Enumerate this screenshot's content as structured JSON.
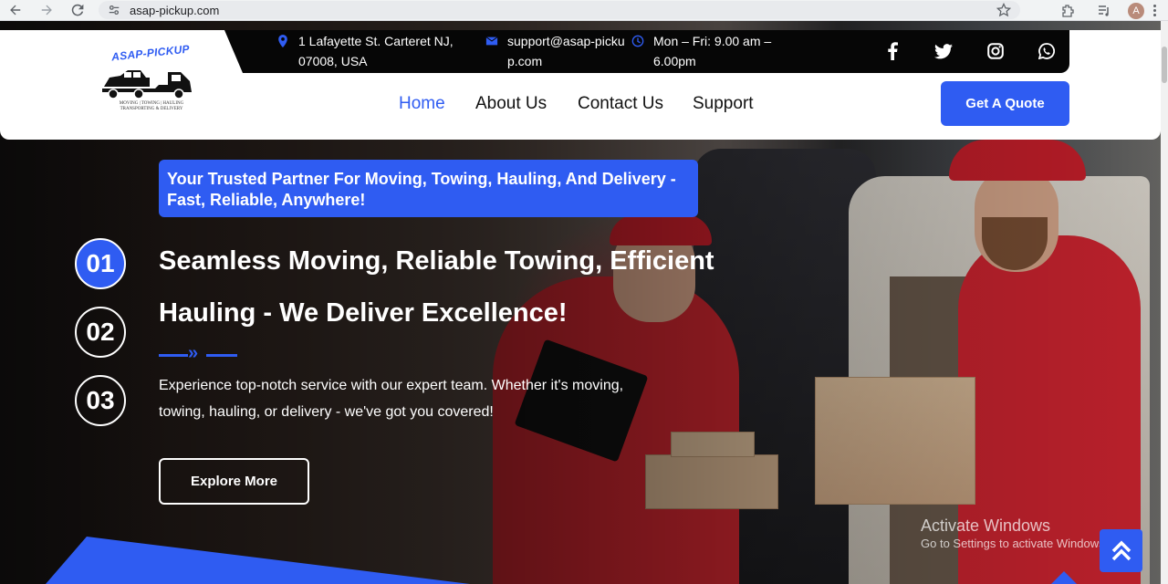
{
  "browser": {
    "url": "asap-pickup.com",
    "avatar_letter": "A"
  },
  "logo": {
    "name": "ASAP-PICKUP",
    "tagline": "MOVING | TOWING | HAULING TRANSPORTING & DELIVERY"
  },
  "topbar": {
    "address": "1 Lafayette St. Carteret NJ, 07008, USA",
    "email": "support@asap-pickup.com",
    "hours": "Mon – Fri: 9.00 am – 6.00pm",
    "social": [
      "facebook-icon",
      "twitter-icon",
      "instagram-icon",
      "whatsapp-icon"
    ]
  },
  "nav": {
    "items": [
      {
        "label": "Home",
        "active": true
      },
      {
        "label": "About Us",
        "active": false
      },
      {
        "label": "Contact Us",
        "active": false
      },
      {
        "label": "Support",
        "active": false
      }
    ],
    "cta": "Get A Quote"
  },
  "hero": {
    "tagline": "Your Trusted Partner For Moving, Towing, Hauling, And Delivery - Fast, Reliable, Anywhere!",
    "steps": [
      "01",
      "02",
      "03"
    ],
    "headline": "Seamless Moving, Reliable Towing, Efficient Hauling - We Deliver Excellence!",
    "description": "Experience top-notch service with our expert team. Whether it's moving, towing, hauling, or delivery - we've got you covered!",
    "button": "Explore More"
  },
  "watermark": {
    "title": "Activate Windows",
    "subtitle": "Go to Settings to activate Windows."
  },
  "colors": {
    "accent": "#2f5cf2",
    "topbar": "#060606"
  }
}
